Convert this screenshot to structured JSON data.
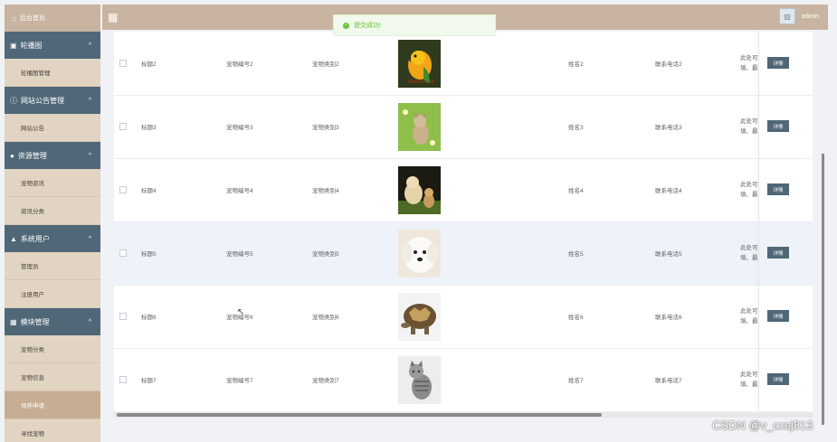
{
  "sidebar": {
    "home": "后台首页",
    "groups": [
      {
        "title": "轮播图",
        "icon": "image-icon",
        "items": [
          "轮播图管理"
        ]
      },
      {
        "title": "网站公告管理",
        "icon": "info-icon",
        "items": [
          "网站公告"
        ]
      },
      {
        "title": "资源管理",
        "icon": "location-icon",
        "items": [
          "宠物资讯",
          "资讯分类"
        ]
      },
      {
        "title": "系统用户",
        "icon": "user-icon",
        "items": [
          "管理员",
          "注册用户"
        ]
      },
      {
        "title": "模块管理",
        "icon": "grid-icon",
        "items": [
          "宠物分类",
          "宠物信息",
          "领养申请",
          "寻找宠物"
        ]
      }
    ],
    "active_item": "领养申请"
  },
  "header": {
    "user": "admin"
  },
  "toast": {
    "message": "提交成功!"
  },
  "table": {
    "rows": [
      {
        "title": "标题2",
        "pet_no": "宠物编号2",
        "pet_type": "宠物类别2",
        "image": "parrot",
        "name": "姓名2",
        "phone": "联系电话2",
        "desc_1": "此处可",
        "desc_2": "填、最",
        "action": "详情"
      },
      {
        "title": "标题3",
        "pet_no": "宠物编号3",
        "pet_type": "宠物类别3",
        "image": "kitten",
        "name": "姓名3",
        "phone": "联系电话3",
        "desc_1": "此处可",
        "desc_2": "填、最",
        "action": "详情"
      },
      {
        "title": "标题4",
        "pet_no": "宠物编号4",
        "pet_type": "宠物类别4",
        "image": "puppies",
        "name": "姓名4",
        "phone": "联系电话4",
        "desc_1": "此处可",
        "desc_2": "填、最",
        "action": "详情"
      },
      {
        "title": "标题5",
        "pet_no": "宠物编号5",
        "pet_type": "宠物类别5",
        "image": "white-dog",
        "name": "姓名5",
        "phone": "联系电话5",
        "desc_1": "此处可",
        "desc_2": "填、最",
        "action": "详情"
      },
      {
        "title": "标题6",
        "pet_no": "宠物编号6",
        "pet_type": "宠物类别6",
        "image": "tortoise",
        "name": "姓名6",
        "phone": "联系电话6",
        "desc_1": "此处可",
        "desc_2": "填、最",
        "action": "详情"
      },
      {
        "title": "标题7",
        "pet_no": "宠物编号7",
        "pet_type": "宠物类别7",
        "image": "tabby-cat",
        "name": "姓名7",
        "phone": "联系电话7",
        "desc_1": "此处可",
        "desc_2": "填、最",
        "action": "详情"
      }
    ]
  },
  "watermark": "CSDN @v_cxsj813",
  "colors": {
    "sidebar_bg": "#e2d4c2",
    "group_head": "#506777",
    "topbar": "#c8b4a0",
    "success": "#67c23a",
    "highlight_row": "#eef3fa"
  }
}
